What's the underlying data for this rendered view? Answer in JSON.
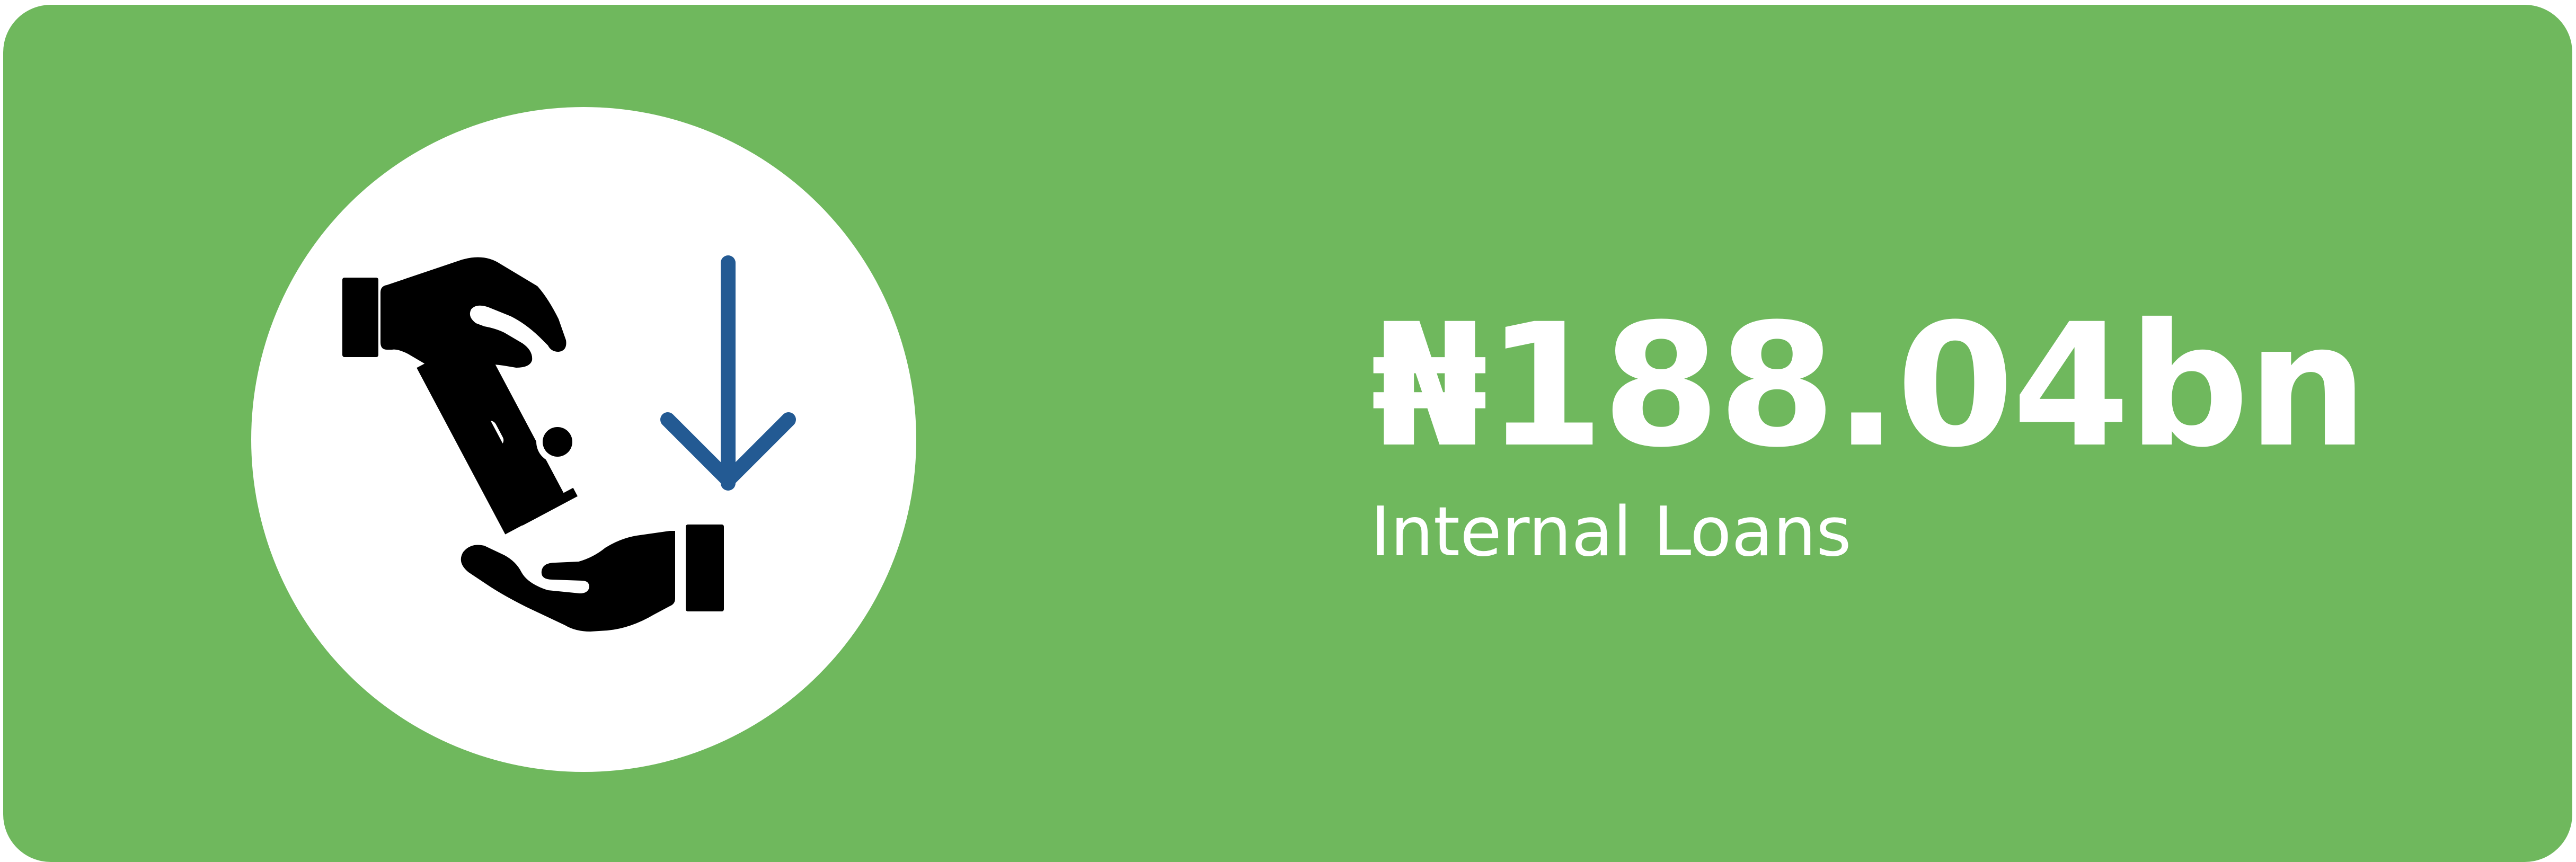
{
  "card": {
    "background_color": "#6fb85d",
    "icon": {
      "name": "money-hand-to-hand-icon",
      "arrow_color": "#235a93"
    },
    "value": "₦188.04bn",
    "label": "Internal Loans"
  }
}
